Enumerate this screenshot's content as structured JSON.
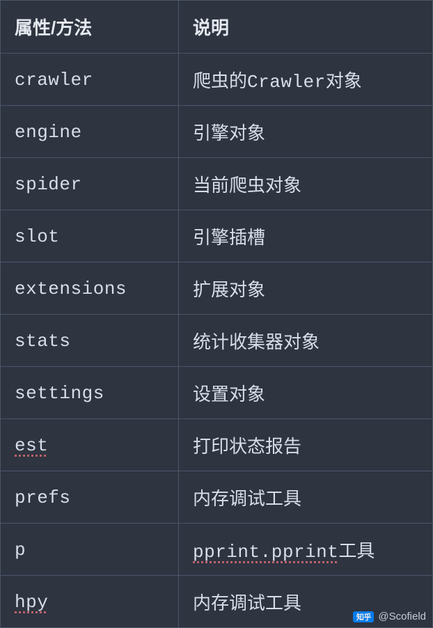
{
  "table": {
    "headers": {
      "key": "属性/方法",
      "desc": "说明"
    },
    "rows": [
      {
        "key": "crawler",
        "desc_pre": "爬虫的",
        "desc_mono": "Crawler",
        "desc_post": "对象",
        "key_spellcheck": false
      },
      {
        "key": "engine",
        "desc_pre": "引擎对象",
        "desc_mono": "",
        "desc_post": "",
        "key_spellcheck": false
      },
      {
        "key": "spider",
        "desc_pre": "当前爬虫对象",
        "desc_mono": "",
        "desc_post": "",
        "key_spellcheck": false
      },
      {
        "key": "slot",
        "desc_pre": "引擎插槽",
        "desc_mono": "",
        "desc_post": "",
        "key_spellcheck": false
      },
      {
        "key": "extensions",
        "desc_pre": "扩展对象",
        "desc_mono": "",
        "desc_post": "",
        "key_spellcheck": false
      },
      {
        "key": "stats",
        "desc_pre": "统计收集器对象",
        "desc_mono": "",
        "desc_post": "",
        "key_spellcheck": false
      },
      {
        "key": "settings",
        "desc_pre": "设置对象",
        "desc_mono": "",
        "desc_post": "",
        "key_spellcheck": false
      },
      {
        "key": "est",
        "desc_pre": "打印状态报告",
        "desc_mono": "",
        "desc_post": "",
        "key_spellcheck": true
      },
      {
        "key": "prefs",
        "desc_pre": "内存调试工具",
        "desc_mono": "",
        "desc_post": "",
        "key_spellcheck": false
      },
      {
        "key": "p",
        "desc_pre": "",
        "desc_mono": "pprint.pprint",
        "desc_post": "工具",
        "key_spellcheck": false,
        "desc_mono_spellcheck": true
      },
      {
        "key": "hpy",
        "desc_pre": "内存调试工具",
        "desc_mono": "",
        "desc_post": "",
        "key_spellcheck": true
      }
    ]
  },
  "watermark": {
    "icon_text": "知乎",
    "text": "@Scofield"
  }
}
